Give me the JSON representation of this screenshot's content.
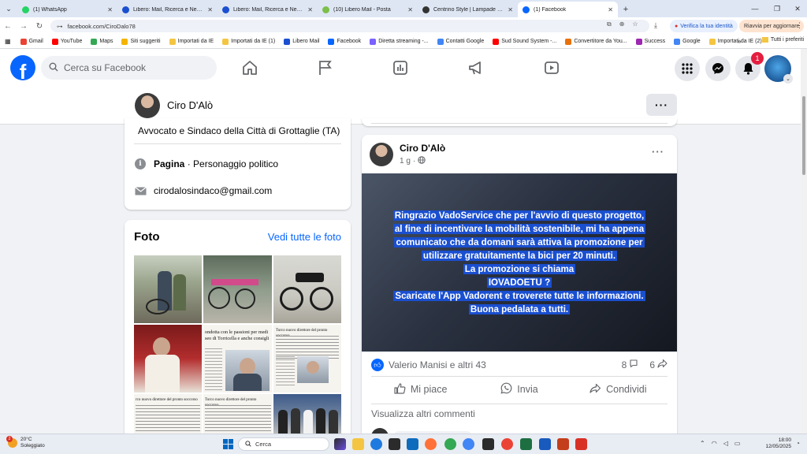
{
  "browser": {
    "tabs": [
      {
        "label": "(1) WhatsApp",
        "color": "#25d366"
      },
      {
        "label": "Libero: Mail, Ricerca e News co",
        "color": "#1a4fd0"
      },
      {
        "label": "Libero: Mail, Ricerca e News co",
        "color": "#1a4fd0"
      },
      {
        "label": "(10) Libero Mail - Posta",
        "color": "#7cbf4a"
      },
      {
        "label": "Centrino Style | Lampade e App",
        "color": "#333333"
      },
      {
        "label": "(1) Facebook",
        "color": "#0866ff",
        "active": true
      }
    ],
    "url": "facebook.com/CiroDalo78",
    "verify_label": "Verifica la tua identità",
    "restart_label": "Riavvia per aggiornare",
    "bookmarks": [
      {
        "label": "Gmail",
        "color": "#ea4335"
      },
      {
        "label": "YouTube",
        "color": "#ff0000"
      },
      {
        "label": "Maps",
        "color": "#34a853"
      },
      {
        "label": "Siti suggeriti",
        "color": "#f4b400"
      },
      {
        "label": "Importati da IE",
        "color": "#f4c542"
      },
      {
        "label": "Importati da IE (1)",
        "color": "#f4c542"
      },
      {
        "label": "Libero Mail",
        "color": "#1a4fd0"
      },
      {
        "label": "Facebook",
        "color": "#0866ff"
      },
      {
        "label": "Diretta streaming -...",
        "color": "#7b61ff"
      },
      {
        "label": "Contatti Google",
        "color": "#4285f4"
      },
      {
        "label": "Sud Sound System -...",
        "color": "#ff0000"
      },
      {
        "label": "Convertitore da You...",
        "color": "#e8710a"
      },
      {
        "label": "Success",
        "color": "#9c27b0"
      },
      {
        "label": "Google",
        "color": "#4285f4"
      },
      {
        "label": "Importati da IE (2)",
        "color": "#f4c542"
      }
    ],
    "bookmarks_more": "»",
    "all_bookmarks": "Tutti i preferiti"
  },
  "header": {
    "search_placeholder": "Cerca su Facebook",
    "notif_count": "1"
  },
  "page": {
    "name": "Ciro D'Alò"
  },
  "intro": {
    "bio": "Avvocato e Sindaco della Città di Grottaglie (TA)",
    "category_bold": "Pagina",
    "category_rest": " · Personaggio politico",
    "email": "cirodalosindaco@gmail.com"
  },
  "photos": {
    "title": "Foto",
    "see_all": "Vedi tutte le foto",
    "news": [
      {
        "l1": "ondotta con le passioni per medi",
        "l2": "seo di Torricella e anche consigli"
      },
      {
        "l1": "Turco nuovo direttore del pronto soccorso",
        "l2": ""
      },
      {
        "l1": "rco nuovo direttore del pronto soccorso",
        "l2": ""
      },
      {
        "l1": "Turco nuovo direttore del pronto soccorso",
        "l2": ""
      }
    ]
  },
  "post": {
    "author": "Ciro D'Alò",
    "time": "1 g",
    "lines": [
      "Ringrazio VadoService che per l'avvio di questo progetto,",
      "al fine di incentivare la mobilità sostenibile, mi ha appena",
      "comunicato che da domani sarà attiva la promozione per",
      "utilizzare gratuitamente la bici per 20 minuti.",
      "La promozione si chiama",
      "IOVADOETU ?",
      "Scaricate l'App Vadorent e troverete tutte le informazioni.",
      "Buona pedalata a tutti."
    ],
    "reactions": "Valerio Manisi e altri 43",
    "comments": "8",
    "shares": "6",
    "like_label": "Mi piace",
    "send_label": "Invia",
    "share_label": "Condividi",
    "more_comments": "Visualizza altri commenti"
  },
  "taskbar": {
    "weather_temp": "20°C",
    "weather_desc": "Soleggiato",
    "weather_badge": "2",
    "search_label": "Cerca",
    "time": "18:00",
    "date": "12/05/2025"
  }
}
